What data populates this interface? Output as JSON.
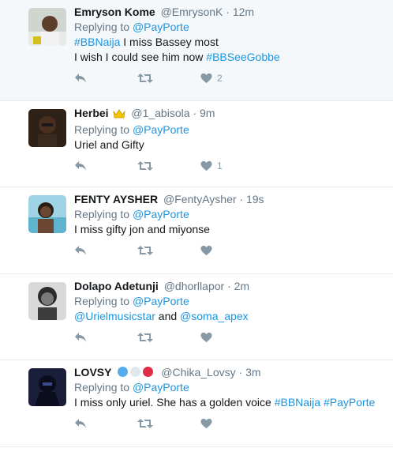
{
  "tweets": [
    {
      "name": "Emryson Kome",
      "handle": "@EmrysonK",
      "time": "12m",
      "replying": "Replying to",
      "mention": "@PayPorte",
      "hashtag1": "#BBNaija",
      "text1": " I miss Bassey most",
      "text2": "I wish I could see him now ",
      "hashtag2": "#BBSeeGobbe",
      "likes": "2"
    },
    {
      "name": "Herbei",
      "handle": "@1_abisola",
      "time": "9m",
      "replying": "Replying to",
      "mention": "@PayPorte",
      "text": "Uriel and Gifty",
      "likes": "1"
    },
    {
      "name": "FENTY AYSHER",
      "handle": "@FentyAysher",
      "time": "19s",
      "replying": "Replying to",
      "mention": "@PayPorte",
      "text": "I miss gifty jon and miyonse"
    },
    {
      "name": "Dolapo Adetunji",
      "handle": "@dhorllapor",
      "time": "2m",
      "replying": "Replying to",
      "mention": "@PayPorte",
      "mention1": "@Urielmusicstar",
      "and": " and ",
      "mention2": "@soma_apex"
    },
    {
      "name": "LOVSY",
      "handle": "@Chika_Lovsy",
      "time": "3m",
      "replying": "Replying to",
      "mention": "@PayPorte",
      "text": "I miss only uriel. She has a golden voice ",
      "hashtag1": "#BBNaija",
      "hashtag2": "#PayPorte"
    }
  ],
  "separator": "·",
  "icons": {
    "reply": "reply-icon",
    "retweet": "retweet-icon",
    "like": "heart-icon"
  },
  "colors": {
    "link": "#1b95e0",
    "muted": "#657786",
    "icon": "#8899a6",
    "highlight_bg": "#f5f8fa"
  }
}
